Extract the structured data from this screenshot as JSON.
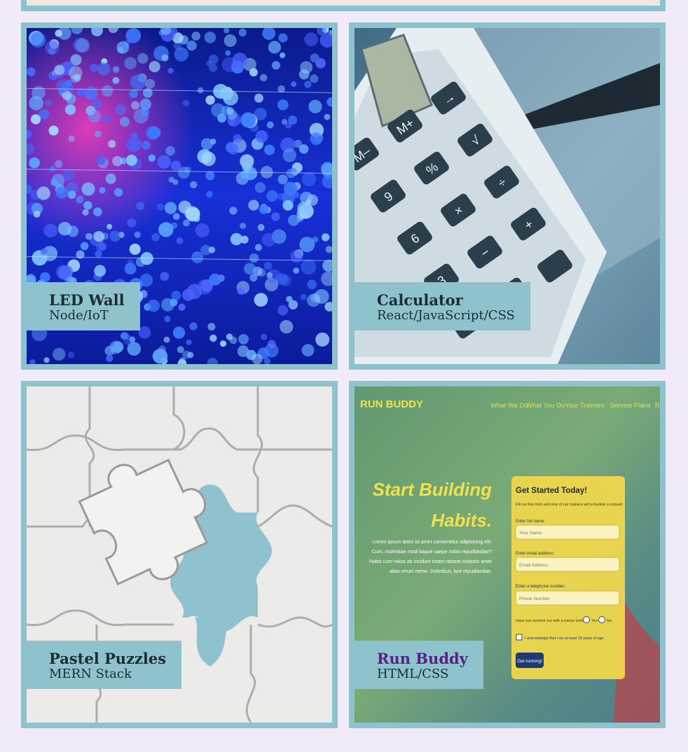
{
  "projects": [
    {
      "title": "LED Wall",
      "tech": "Node/IoT",
      "image": "blue-bokeh-lights"
    },
    {
      "title": "Calculator",
      "tech": "React/JavaScript/CSS",
      "image": "calculator-and-pen"
    },
    {
      "title": "Pastel Puzzles",
      "tech": "MERN Stack",
      "image": "white-puzzle-pieces"
    },
    {
      "title": "Run Buddy",
      "tech": "HTML/CSS",
      "image": "run-buddy-site-screenshot",
      "preview": {
        "brand": "RUN BUDDY",
        "nav": [
          "What We Do",
          "What You Do",
          "Your Trainers",
          "Service Plans",
          "Reach Out"
        ],
        "hero_line1": "Start Building",
        "hero_line2": "Habits.",
        "hero_text": [
          "Lorem ipsum dolor sit amet consectetur adipisicing elit.",
          "Cum, molestiae modi itaque saepe nobis repudiandae?",
          "Nobis cum natus ab incidunt totam ratione corporis amet",
          "alias rerum nemo. Doloribus, iure repudiandae."
        ],
        "form_title": "Get Started Today!",
        "form_sub": "Fill out this form and one of our trainers will schedule a consult.",
        "name_label": "Enter full name:",
        "name_ph": "Your Name",
        "email_label": "Enter email address:",
        "email_ph": "Email Address",
        "phone_label": "Enter a telephone number:",
        "phone_ph": "Phone Number",
        "trainer_q": "Have you worked out with a trainer before?",
        "yes": "Yes",
        "no": "No",
        "ack": "I acknowledge that I am at least 18 years of age.",
        "submit": "Get running!"
      }
    }
  ],
  "colors": {
    "page_bg": "#f1eaf8",
    "card_frame": "#8ec3cd",
    "visited_link": "#5b1f8c"
  }
}
